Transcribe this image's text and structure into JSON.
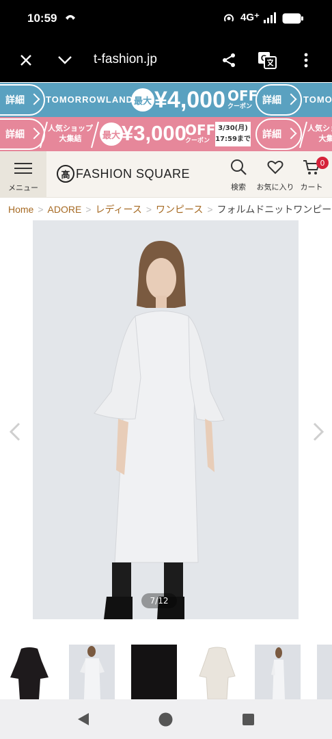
{
  "status_bar": {
    "time": "10:59",
    "network": "4G⁺"
  },
  "browser": {
    "url": "t-fashion.jp"
  },
  "banners": [
    {
      "pill_label": "詳細",
      "brand": "TOMORROWLAND",
      "badge": "最大",
      "amount": "¥4,000",
      "off": "OFF",
      "coupon": "クーポン",
      "pill_label_2": "詳細",
      "brand_2": "TOMO",
      "color": "#5aa1c0"
    },
    {
      "pill_label": "詳細",
      "shop_line1": "人気ショップ",
      "shop_line2": "大集結",
      "badge": "最大",
      "amount": "¥3,000",
      "off": "OFF",
      "coupon": "クーポン",
      "date_line1": "3/30(月)",
      "date_line2": "17:59まで",
      "pill_label_2": "詳細",
      "shop_line1_2": "人気ショッ",
      "shop_line2_2": "大集",
      "color": "#e6879a"
    }
  ],
  "header": {
    "menu_label": "メニュー",
    "logo_mark": "髙",
    "logo_text": "FASHION SQUARE",
    "search_label": "検索",
    "favorites_label": "お気に入り",
    "cart_label": "カート",
    "cart_count": "0"
  },
  "breadcrumb": {
    "items": [
      "Home",
      "ADORE",
      "レディース",
      "ワンピース"
    ],
    "current": "フォルムドニットワンピース"
  },
  "gallery": {
    "counter": "7/12",
    "current_index": 7,
    "total": 12
  },
  "thumbnails": [
    "dress-black",
    "model-grey-front",
    "fabric-black",
    "dress-beige",
    "model-grey-side",
    "model-partial"
  ],
  "colors": {
    "breadcrumb_link": "#a66a23",
    "cart_badge": "#d5223a",
    "banner_blue": "#5aa1c0",
    "banner_pink": "#e6879a"
  }
}
